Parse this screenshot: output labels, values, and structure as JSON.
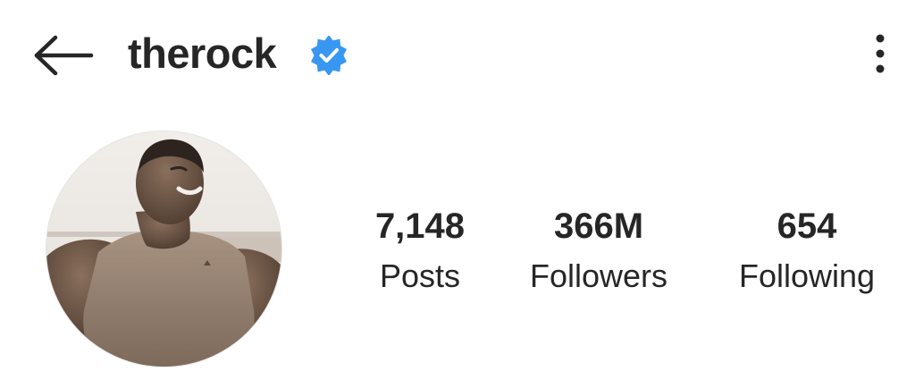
{
  "header": {
    "username": "therock",
    "icons": {
      "back": "back-arrow-icon",
      "verified": "verified-badge-icon",
      "more": "more-vertical-icon"
    },
    "accent_color": "#3897f0"
  },
  "profile": {
    "avatar_alt": "therock profile photo",
    "stats": [
      {
        "value": "7,148",
        "label": "Posts"
      },
      {
        "value": "366M",
        "label": "Followers"
      },
      {
        "value": "654",
        "label": "Following"
      }
    ]
  }
}
